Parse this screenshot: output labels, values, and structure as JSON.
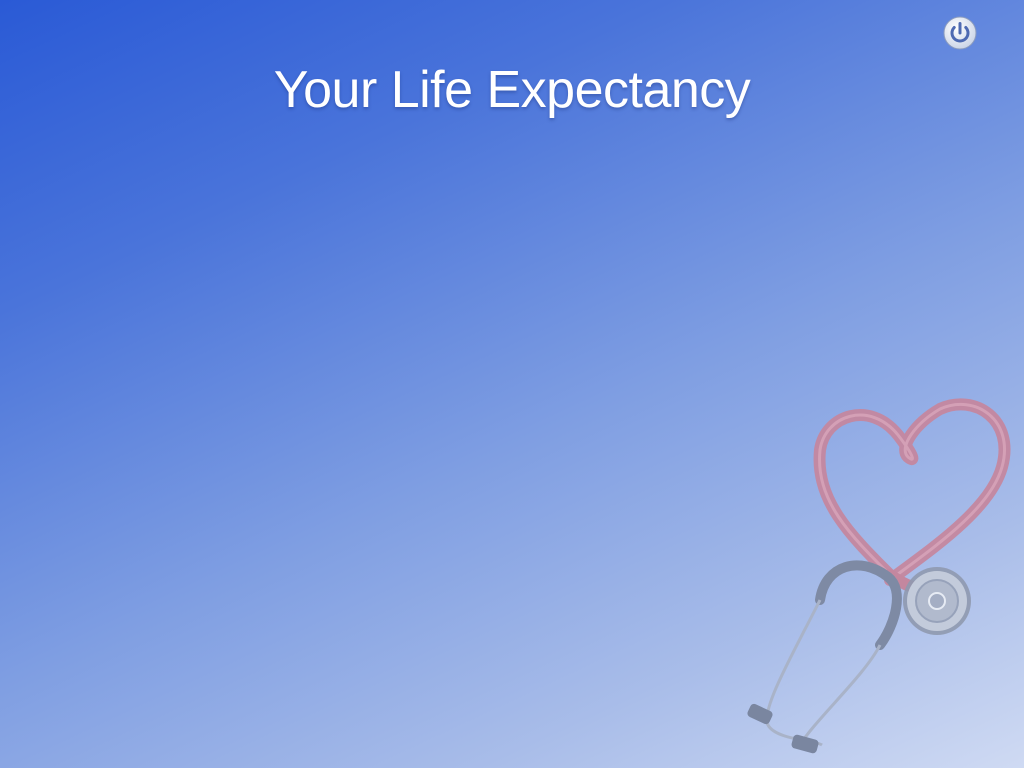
{
  "header": {
    "title": "Your Life Expectancy"
  },
  "controls": {
    "power_icon": "power-icon"
  },
  "decoration": {
    "image_icon": "stethoscope-heart-icon"
  },
  "colors": {
    "background_top": "#2a5ad6",
    "background_bottom": "#cfdaf3",
    "title_text": "#ffffff",
    "tubing": "#c88aa8",
    "chestpiece": "#a8b2c6"
  }
}
